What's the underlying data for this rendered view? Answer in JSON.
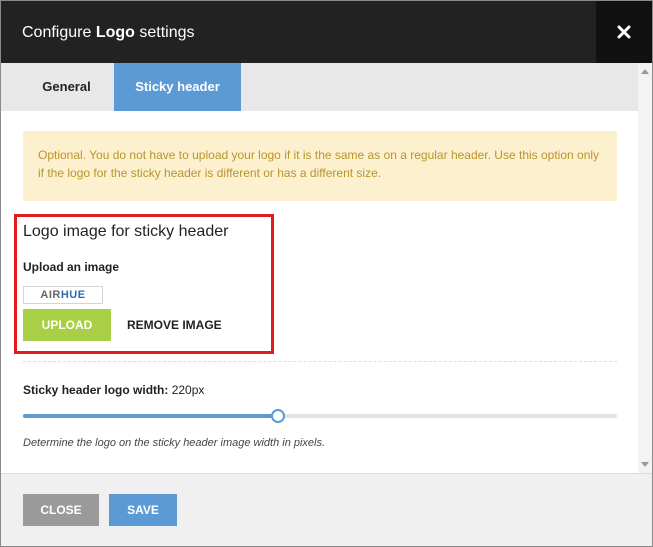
{
  "modal": {
    "title_prefix": "Configure ",
    "title_bold": "Logo",
    "title_suffix": " settings",
    "close_icon": "close-icon"
  },
  "tabs": [
    {
      "label": "General",
      "active": false
    },
    {
      "label": "Sticky header",
      "active": true
    }
  ],
  "notice": {
    "text": "Optional. You do not have to upload your logo if it is the same as on a regular header. Use this option only if the logo for the sticky header is different or has a different size."
  },
  "logo_section": {
    "title": "Logo image for sticky header",
    "upload_label": "Upload an image",
    "thumb_text_a": "AIR",
    "thumb_text_b": "HUE",
    "upload_button": "UPLOAD",
    "remove_button": "REMOVE IMAGE"
  },
  "width_setting": {
    "label": "Sticky header logo width:",
    "value": "220px",
    "slider_fraction": 0.43,
    "help": "Determine the logo on the sticky header image width in pixels."
  },
  "footer": {
    "close_label": "CLOSE",
    "save_label": "SAVE"
  },
  "colors": {
    "header_bg": "#222222",
    "accent_blue": "#5b9ad5",
    "upload_green": "#a8cf45",
    "notice_bg": "#fdf0cf",
    "notice_text": "#b8952b",
    "highlight_red": "#e01b1b"
  }
}
